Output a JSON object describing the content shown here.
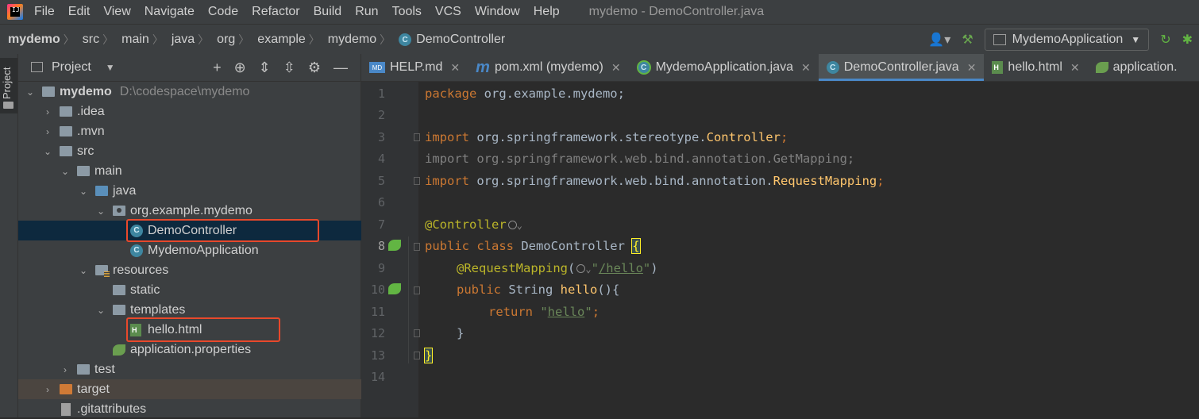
{
  "menu": {
    "items": [
      "File",
      "Edit",
      "View",
      "Navigate",
      "Code",
      "Refactor",
      "Build",
      "Run",
      "Tools",
      "VCS",
      "Window",
      "Help"
    ],
    "window_title": "mydemo - DemoController.java"
  },
  "breadcrumb": {
    "items": [
      "mydemo",
      "src",
      "main",
      "java",
      "org",
      "example",
      "mydemo",
      "DemoController"
    ]
  },
  "run_config": {
    "label": "MydemoApplication"
  },
  "left_stripe": {
    "project_tab": "Project"
  },
  "project_panel": {
    "title": "Project",
    "tree": [
      {
        "label": "mydemo",
        "path": "D:\\codespace\\mydemo"
      },
      {
        "label": ".idea"
      },
      {
        "label": ".mvn"
      },
      {
        "label": "src"
      },
      {
        "label": "main"
      },
      {
        "label": "java"
      },
      {
        "label": "org.example.mydemo"
      },
      {
        "label": "DemoController"
      },
      {
        "label": "MydemoApplication"
      },
      {
        "label": "resources"
      },
      {
        "label": "static"
      },
      {
        "label": "templates"
      },
      {
        "label": "hello.html"
      },
      {
        "label": "application.properties"
      },
      {
        "label": "test"
      },
      {
        "label": "target"
      },
      {
        "label": ".gitattributes"
      }
    ]
  },
  "tabs": [
    {
      "label": "HELP.md",
      "icon": "markdown-icon"
    },
    {
      "label": "pom.xml (mydemo)",
      "icon": "maven-icon"
    },
    {
      "label": "MydemoApplication.java",
      "icon": "spring-boot-icon"
    },
    {
      "label": "DemoController.java",
      "icon": "class-icon",
      "active": true
    },
    {
      "label": "hello.html",
      "icon": "html-icon"
    },
    {
      "label": "application.",
      "icon": "spring-properties-icon"
    }
  ],
  "editor": {
    "line_numbers": [
      "1",
      "2",
      "3",
      "4",
      "5",
      "6",
      "7",
      "8",
      "9",
      "10",
      "11",
      "12",
      "13",
      "14"
    ],
    "code": {
      "l1_kw": "package",
      "l1_rest": " org.example.mydemo;",
      "l3_kw": "import",
      "l3_pkg": " org.springframework.stereotype.",
      "l3_cls": "Controller",
      "l3_end": ";",
      "l4": "import org.springframework.web.bind.annotation.GetMapping;",
      "l5_kw": "import",
      "l5_pkg": " org.springframework.web.bind.annotation.",
      "l5_cls": "RequestMapping",
      "l5_end": ";",
      "l7_ann": "@Controller",
      "l8_kw": "public class",
      "l8_name": " DemoController ",
      "l8_brace": "{",
      "l9_ann": "@RequestMapping",
      "l9_open": "(",
      "l9_q1": "\"",
      "l9_path": "/hello",
      "l9_q2": "\"",
      "l9_close": ")",
      "l10_kw": "public",
      "l10_type": " String ",
      "l10_fn": "hello",
      "l10_rest": "(){",
      "l11_kw": "return",
      "l11_q1": " \"",
      "l11_str": "hello",
      "l11_q2": "\"",
      "l11_end": ";",
      "l12": "}",
      "l13": "}"
    }
  }
}
